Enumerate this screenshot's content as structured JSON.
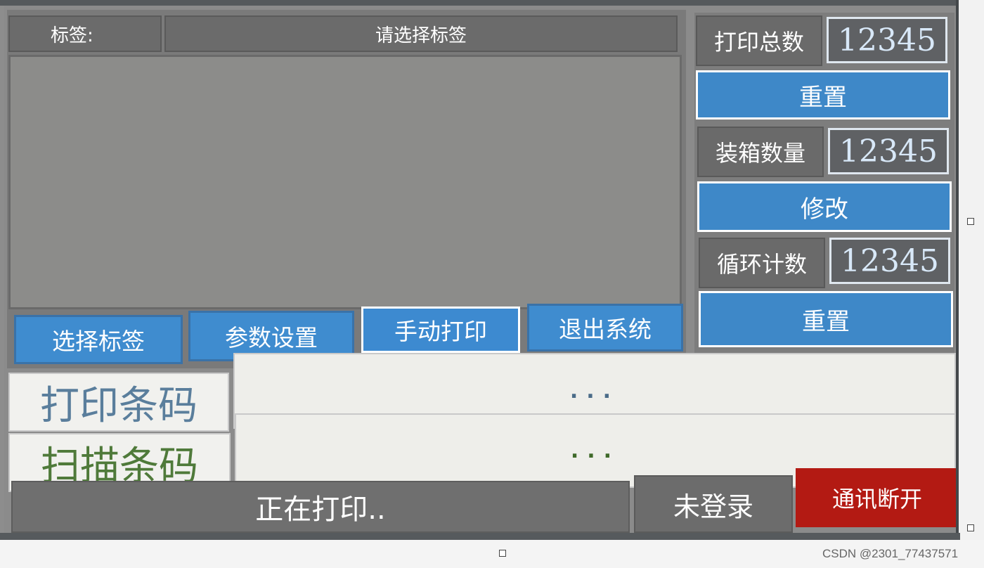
{
  "label_bar": {
    "label": "标签:",
    "value": "请选择标签"
  },
  "buttons": [
    {
      "label": "选择标签",
      "selected": false
    },
    {
      "label": "参数设置",
      "selected": false
    },
    {
      "label": "手动打印",
      "selected": true
    },
    {
      "label": "退出系统",
      "selected": false
    }
  ],
  "counters": {
    "print_total": {
      "label": "打印总数",
      "value": "12345",
      "action": "重置"
    },
    "box_qty": {
      "label": "装箱数量",
      "value": "12345",
      "action": "修改"
    },
    "cycle_count": {
      "label": "循环计数",
      "value": "12345",
      "action": "重置"
    }
  },
  "barcodes": {
    "print": {
      "label": "打印条码",
      "value": "...",
      "label_color": "#5a7e9c",
      "dots_color": "#4a6b88"
    },
    "scan": {
      "label": "扫描条码",
      "value": "...",
      "label_color": "#4f7a3a",
      "dots_color": "#3f6a2a"
    }
  },
  "status": {
    "message": "正在打印..",
    "login": "未登录",
    "comm": "通讯断开",
    "comm_color": "#b31a13"
  },
  "watermark": "CSDN @2301_77437571"
}
